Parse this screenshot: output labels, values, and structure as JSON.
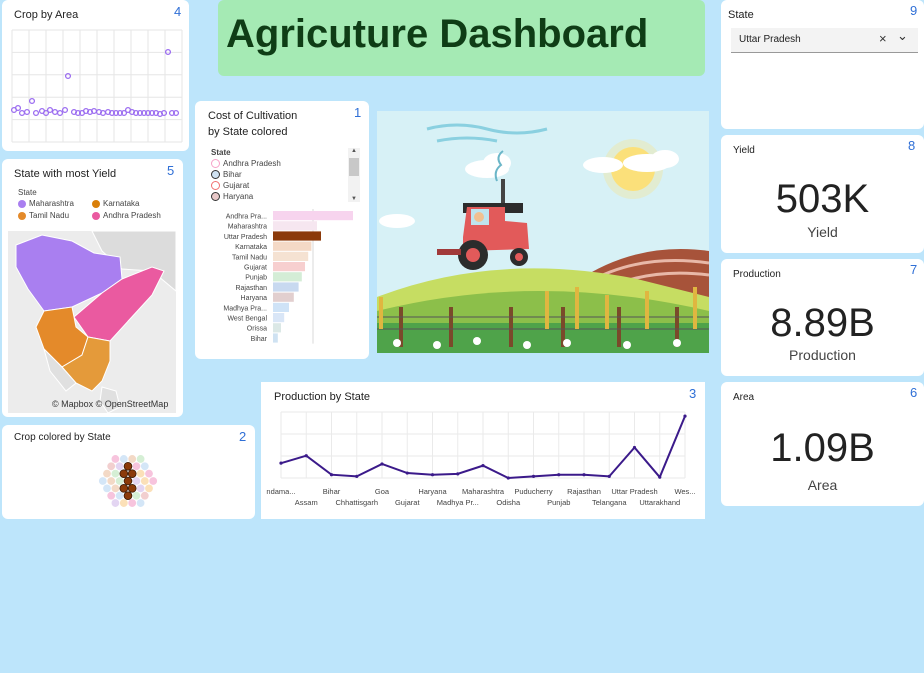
{
  "header": {
    "title": "Agricuture Dashboard"
  },
  "crop_by_area": {
    "title": "Crop by Area",
    "badge": "4",
    "chart_data": {
      "type": "scatter",
      "title": "Crop by Area",
      "values": [
        108,
        110,
        107,
        113,
        101,
        109,
        112,
        110,
        108,
        112,
        108,
        131,
        111,
        109,
        110,
        112,
        109,
        108,
        108,
        111,
        110,
        109,
        108,
        108,
        108,
        109,
        110,
        109,
        107,
        112,
        113,
        108,
        108,
        108,
        108,
        109,
        110,
        109,
        108,
        108,
        108,
        108,
        106,
        107,
        109,
        108,
        110,
        108,
        108,
        109,
        107,
        110,
        108,
        108,
        108,
        108,
        108,
        108,
        110,
        110,
        108,
        108,
        108,
        108,
        108,
        108,
        108,
        108,
        108,
        108,
        108,
        108,
        108,
        110,
        108,
        108,
        108,
        109,
        108,
        108,
        108,
        110,
        108,
        108,
        108,
        108,
        108,
        107,
        108,
        108,
        108,
        108,
        108,
        108,
        108,
        108,
        108,
        108,
        108,
        108
      ],
      "color": "#9b6cf0"
    }
  },
  "state_most_yield": {
    "title": "State with most Yield",
    "badge": "5",
    "legend_title": "State",
    "legend": [
      {
        "label": "Maharashtra",
        "color": "#a97ff0"
      },
      {
        "label": "Karnataka",
        "color": "#d97f0a"
      },
      {
        "label": "Tamil Nadu",
        "color": "#e48a2a"
      },
      {
        "label": "Andhra Pradesh",
        "color": "#ea5aa0"
      }
    ],
    "attribution": "© Mapbox © OpenStreetMap"
  },
  "crop_by_state": {
    "title": "Crop colored by State",
    "badge": "2"
  },
  "cost_cultivation": {
    "title_line1": "Cost of Cultivation",
    "title_line2": "by State colored",
    "badge": "1",
    "legend_title": "State",
    "legend": [
      {
        "label": "Andhra Pradesh",
        "color": "#f7a3c9"
      },
      {
        "label": "Bihar",
        "color": "#7fa7d6"
      },
      {
        "label": "Gujarat",
        "color": "#f2a6a6"
      },
      {
        "label": "Haryana",
        "color": "#9c4a4a"
      }
    ],
    "chart_data": {
      "type": "bar",
      "orientation": "horizontal",
      "categories": [
        "Andhra Pra...",
        "Maharashtra",
        "Uttar Pradesh",
        "Karnataka",
        "Tamil Nadu",
        "Gujarat",
        "Punjab",
        "Rajasthan",
        "Haryana",
        "Madhya Pra...",
        "West Bengal",
        "Orissa",
        "Bihar"
      ],
      "values": [
        100,
        55,
        60,
        48,
        44,
        40,
        36,
        32,
        26,
        20,
        14,
        10,
        6
      ],
      "colors": [
        "#f7d4ee",
        "#f6e6f0",
        "#8b3a0a",
        "#f4d9c6",
        "#f5e2d2",
        "#f7cfcf",
        "#d4edd6",
        "#c8d9f0",
        "#e2cfcf",
        "#cfe3f7",
        "#d9e6f7",
        "#dbe8e6",
        "#cfe2f2"
      ]
    }
  },
  "production_by_state": {
    "title": "Production by State",
    "badge": "3",
    "chart_data": {
      "type": "line",
      "categories": [
        "Andaman...",
        "Assam",
        "Bihar",
        "Chhattisgarh",
        "Goa",
        "Gujarat",
        "Haryana",
        "Madhya Pr...",
        "Maharashtra",
        "Odisha",
        "Puducherry",
        "Punjab",
        "Rajasthan",
        "Telangana",
        "Uttar Pradesh",
        "Uttarakhand",
        "West..."
      ],
      "tick_labels_row1": [
        "ndama...",
        "Bihar",
        "Goa",
        "Haryana",
        "Maharashtra",
        "Puducherry",
        "Rajasthan",
        "Uttar Pradesh",
        "Wes..."
      ],
      "tick_labels_row2": [
        "Assam",
        "Chhattisgarh",
        "Gujarat",
        "Madhya Pr...",
        "Odisha",
        "Punjab",
        "Telangana",
        "Uttarakhand"
      ],
      "values": [
        0.18,
        0.27,
        0.04,
        0.02,
        0.17,
        0.06,
        0.04,
        0.05,
        0.15,
        0.0,
        0.02,
        0.04,
        0.04,
        0.02,
        0.37,
        0.01,
        0.75
      ],
      "color": "#3b1a8a"
    }
  },
  "state_filter": {
    "title": "State",
    "badge": "9",
    "selected": "Uttar Pradesh",
    "clear_glyph": "×",
    "chevron_glyph": "⌄"
  },
  "yield": {
    "label": "Yield",
    "badge": "8",
    "value": "503K",
    "sub": "Yield"
  },
  "production": {
    "label": "Production",
    "badge": "7",
    "value": "8.89B",
    "sub": "Production"
  },
  "area": {
    "label": "Area",
    "badge": "6",
    "value": "1.09B",
    "sub": "Area"
  }
}
